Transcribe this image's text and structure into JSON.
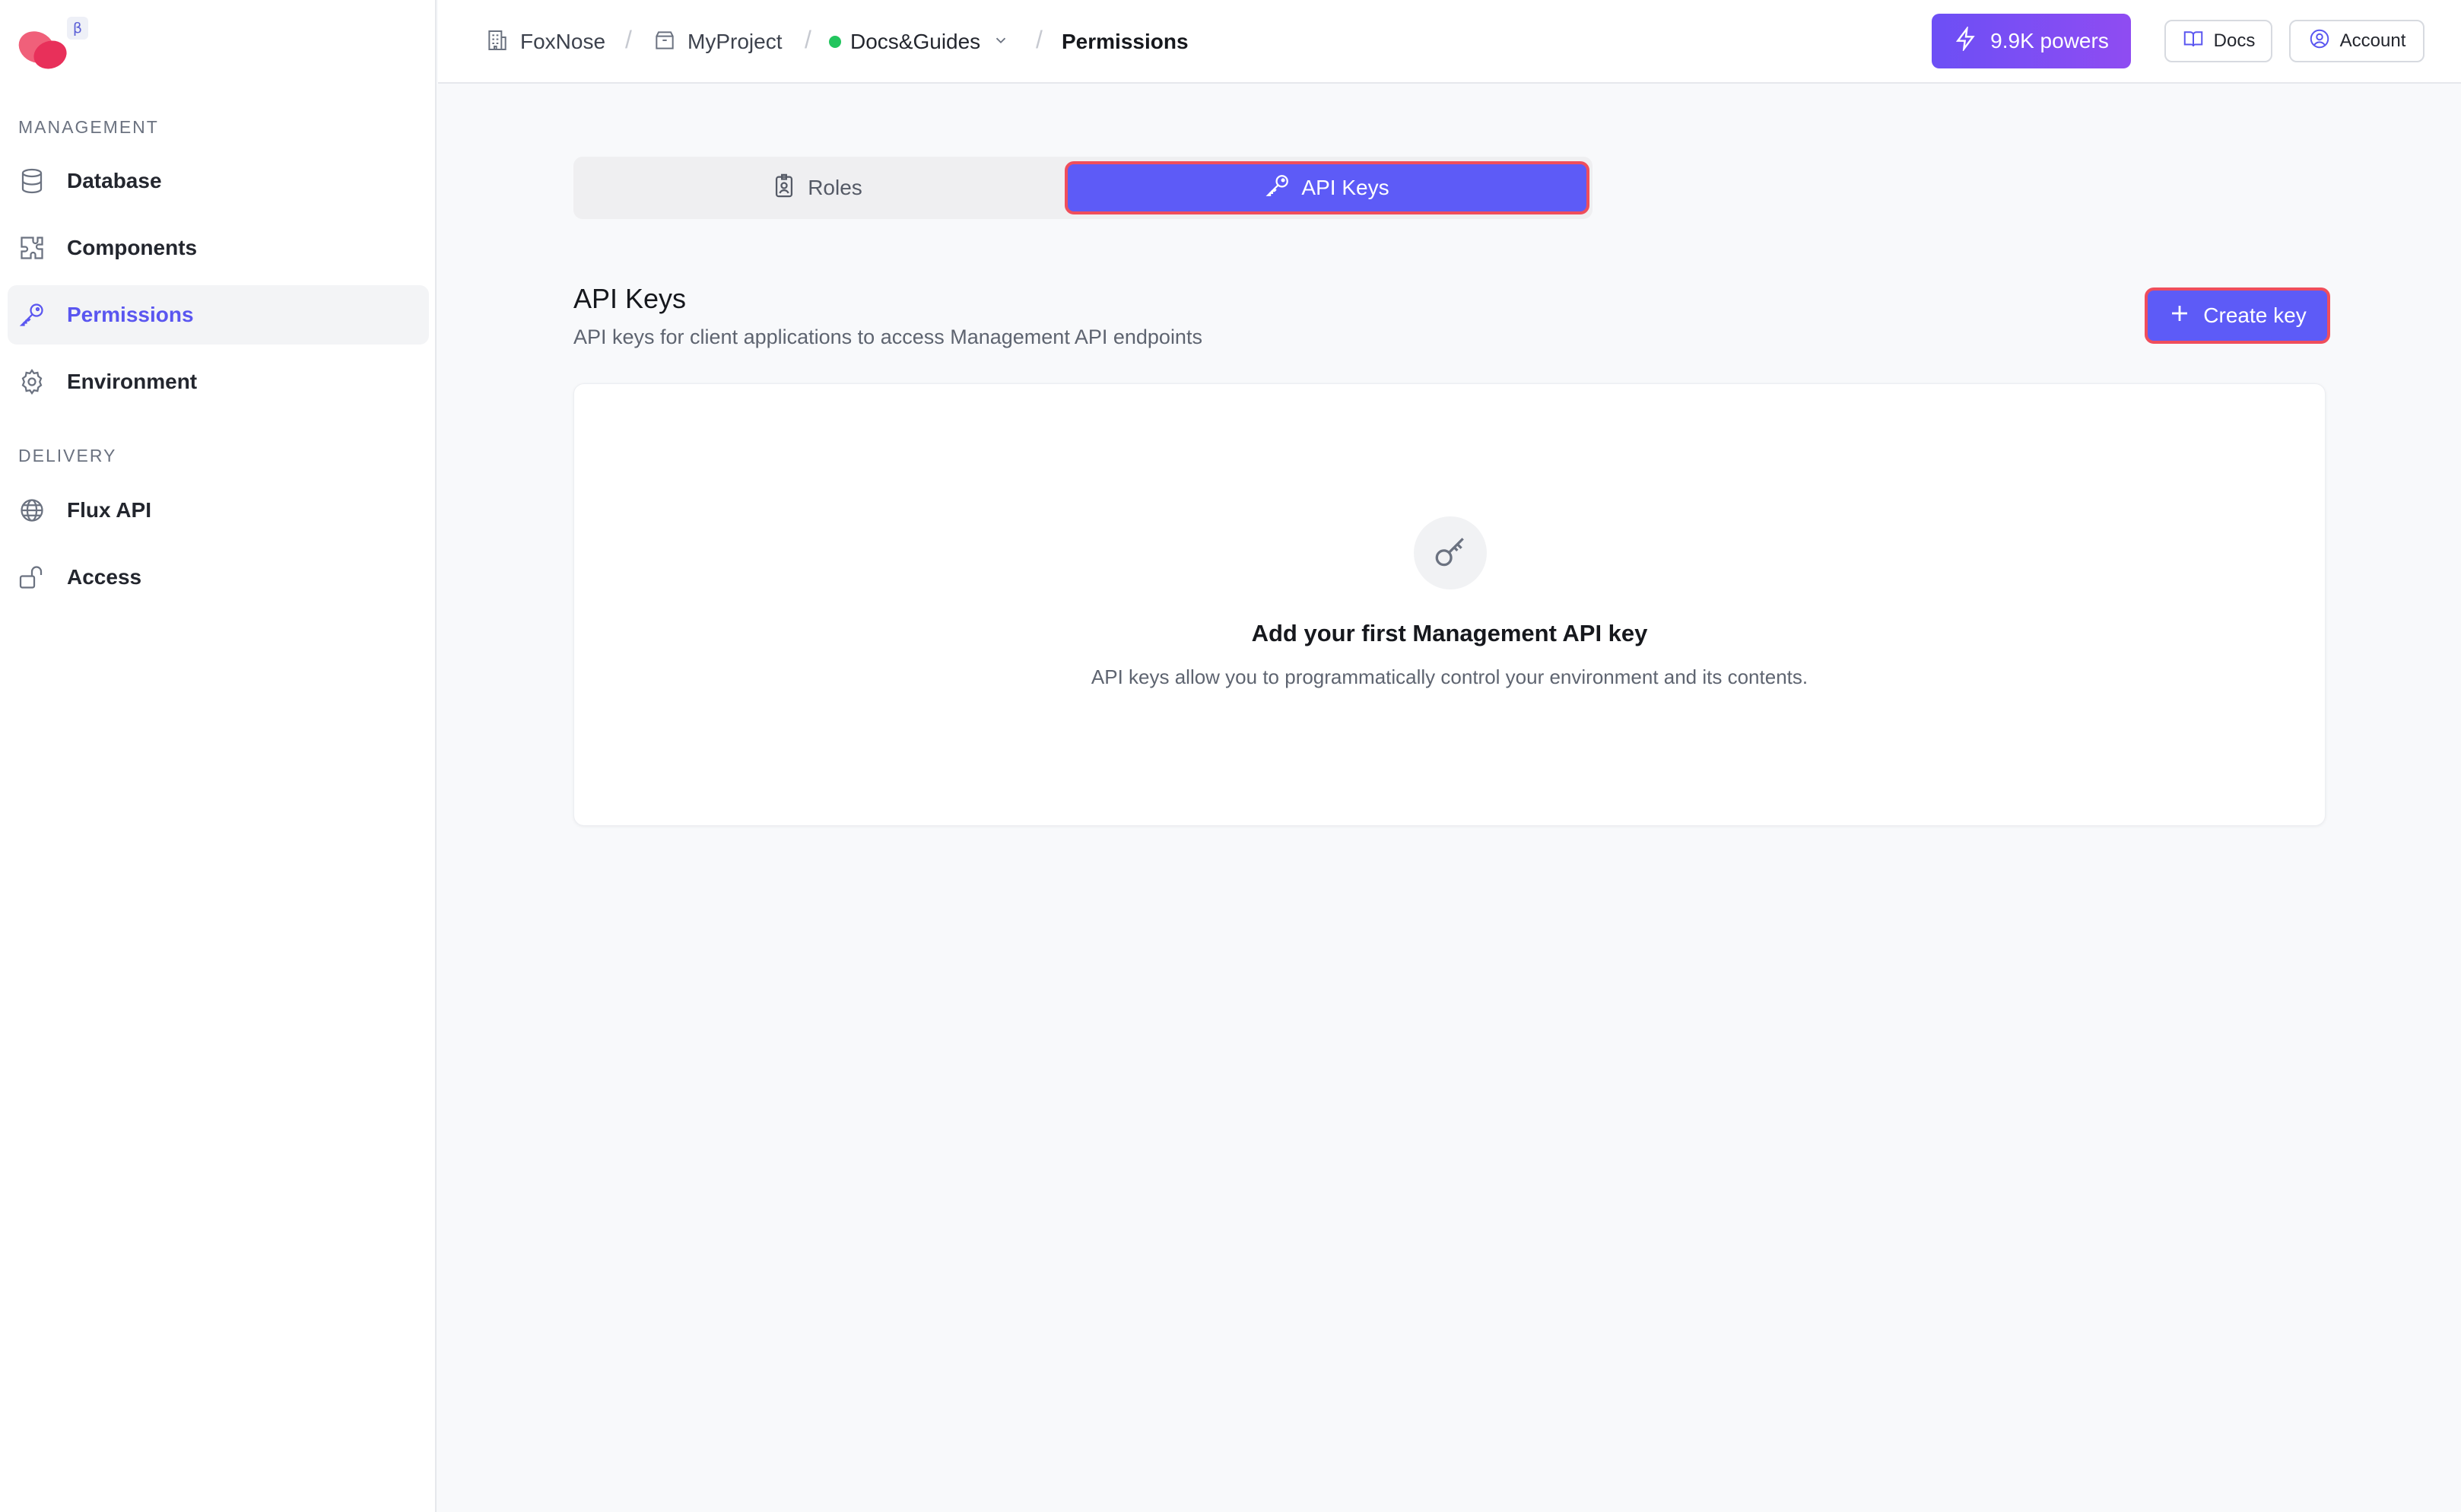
{
  "sidebar": {
    "beta_label": "β",
    "management_title": "MANAGEMENT",
    "delivery_title": "DELIVERY",
    "management_items": [
      {
        "label": "Database",
        "icon": "database-icon"
      },
      {
        "label": "Components",
        "icon": "puzzle-icon"
      },
      {
        "label": "Permissions",
        "icon": "key-icon",
        "active": true
      },
      {
        "label": "Environment",
        "icon": "gear-icon"
      }
    ],
    "delivery_items": [
      {
        "label": "Flux API",
        "icon": "globe-icon"
      },
      {
        "label": "Access",
        "icon": "unlock-icon"
      }
    ]
  },
  "breadcrumb": {
    "org": "FoxNose",
    "project": "MyProject",
    "environment": "Docs&Guides",
    "separator": "/",
    "current": "Permissions"
  },
  "header": {
    "powers_label": "9.9K powers",
    "docs_label": "Docs",
    "account_label": "Account"
  },
  "tabs": [
    {
      "label": "Roles",
      "icon": "badge-icon",
      "selected": false
    },
    {
      "label": "API Keys",
      "icon": "key-icon",
      "selected": true
    }
  ],
  "api_keys": {
    "title": "API Keys",
    "subtitle": "API keys for client applications to access Management API endpoints",
    "create_label": "Create key"
  },
  "empty_state": {
    "icon": "key-icon",
    "title": "Add your first Management API key",
    "description": "API keys allow you to programmatically control your environment and its contents."
  },
  "colors": {
    "accent": "#5d5bf7",
    "active_nav_text": "#5a56f0",
    "highlight_border": "#ef4e5c",
    "env_status": "#22c55e",
    "logo_primary": "#e8305a",
    "logo_secondary": "#f0607a"
  }
}
